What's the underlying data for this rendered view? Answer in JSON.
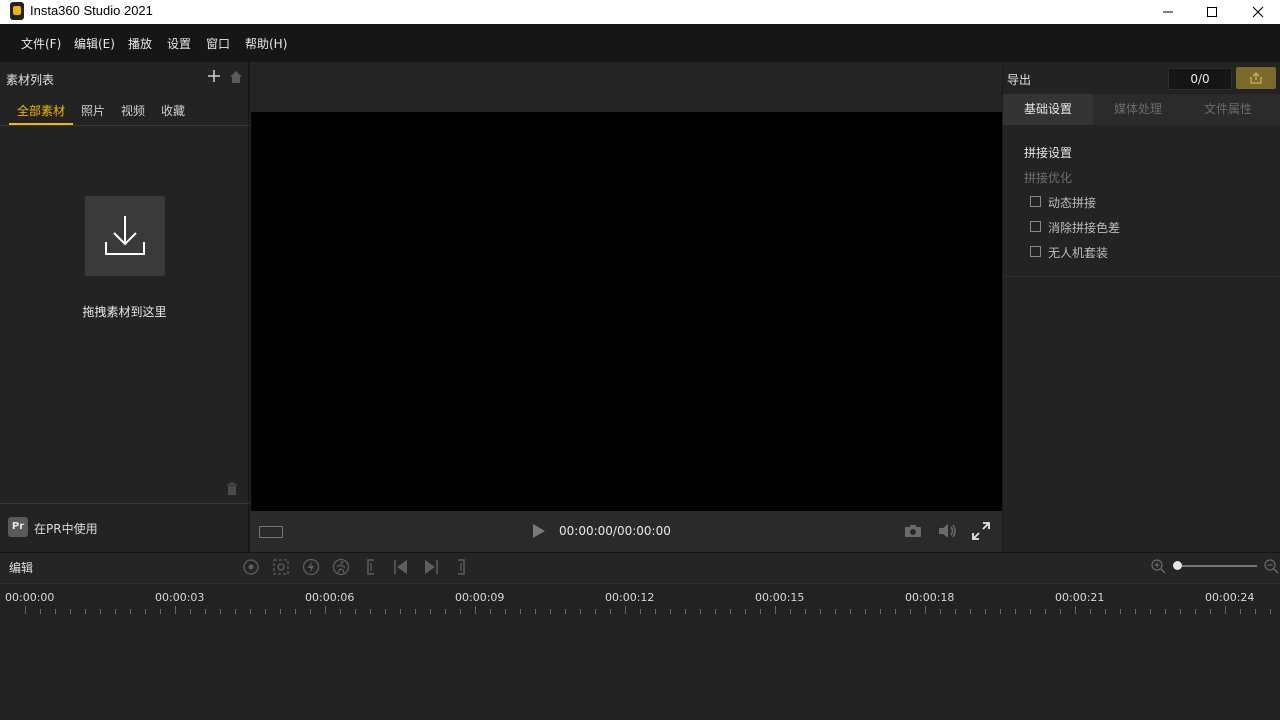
{
  "window": {
    "title": "Insta360 Studio 2021",
    "controls": [
      "minimize-icon",
      "maximize-icon",
      "close-icon"
    ]
  },
  "menu": {
    "items": [
      "文件(F)",
      "编辑(E)",
      "播放",
      "设置",
      "窗口",
      "帮助(H)"
    ]
  },
  "left_panel": {
    "title": "素材列表",
    "tabs": [
      "全部素材",
      "照片",
      "视频",
      "收藏"
    ],
    "active_tab": "全部素材",
    "drop_text": "拖拽素材到这里",
    "pr_badge": "Pr",
    "pr_label": "在PR中使用"
  },
  "player": {
    "time": "00:00:00/00:00:00"
  },
  "right_panel": {
    "title": "导出",
    "counter": "0/0",
    "tabs": [
      "基础设置",
      "媒体处理",
      "文件属性"
    ],
    "active_tab": "基础设置",
    "section_title": "拼接设置",
    "section_sub": "拼接优化",
    "options": [
      {
        "label": "动态拼接",
        "checked": false
      },
      {
        "label": "消除拼接色差",
        "checked": false
      },
      {
        "label": "无人机套装",
        "checked": false
      }
    ]
  },
  "timeline": {
    "label": "编辑",
    "ticks": [
      "00:00:00",
      "00:00:03",
      "00:00:06",
      "00:00:09",
      "00:00:12",
      "00:00:15",
      "00:00:18",
      "00:00:21",
      "00:00:24"
    ]
  },
  "colors": {
    "accent": "#f5b800",
    "background": "#222222",
    "video": "#000000"
  }
}
